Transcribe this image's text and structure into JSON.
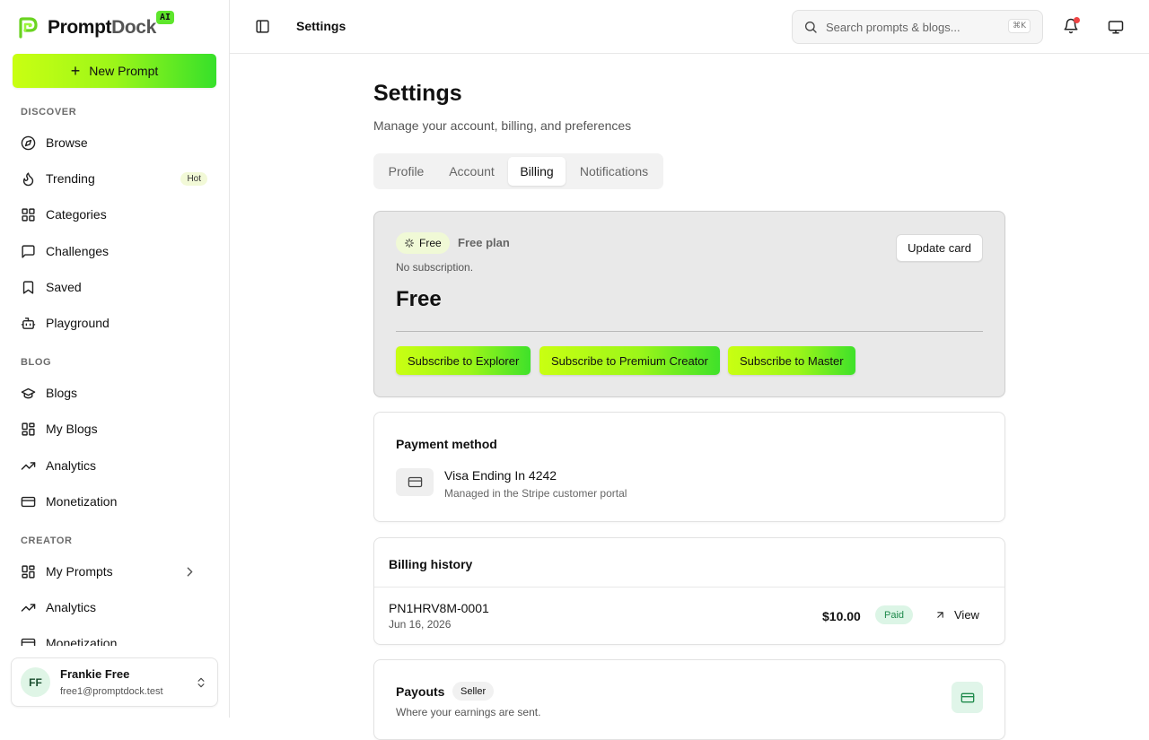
{
  "brand": {
    "name_part1": "Prompt",
    "name_part2": "Dock",
    "badge": "AI"
  },
  "sidebar": {
    "new_prompt_label": "New Prompt",
    "discover_label": "DISCOVER",
    "discover_items": [
      {
        "label": "Browse",
        "icon": "compass-icon"
      },
      {
        "label": "Trending",
        "icon": "flame-icon",
        "badge": "Hot"
      },
      {
        "label": "Categories",
        "icon": "grid-icon"
      },
      {
        "label": "Challenges",
        "icon": "message-square-icon"
      },
      {
        "label": "Saved",
        "icon": "bookmark-icon"
      },
      {
        "label": "Playground",
        "icon": "bot-icon"
      }
    ],
    "blog_label": "BLOG",
    "blog_items": [
      {
        "label": "Blogs",
        "icon": "graduation-cap-icon"
      },
      {
        "label": "My Blogs",
        "icon": "grid-icon"
      },
      {
        "label": "Analytics",
        "icon": "trending-up-icon"
      },
      {
        "label": "Monetization",
        "icon": "credit-card-icon"
      }
    ],
    "creator_label": "CREATOR",
    "creator_items": [
      {
        "label": "My Prompts",
        "icon": "grid-icon"
      },
      {
        "label": "Analytics",
        "icon": "trending-up-icon"
      },
      {
        "label": "Monetization",
        "icon": "credit-card-icon"
      }
    ],
    "user": {
      "initials": "FF",
      "name": "Frankie Free",
      "email": "free1@promptdock.test"
    }
  },
  "topbar": {
    "title": "Settings",
    "search_placeholder": "Search prompts & blogs...",
    "search_shortcut": "⌘K"
  },
  "page": {
    "title": "Settings",
    "subtitle": "Manage your account, billing, and preferences",
    "tabs": [
      "Profile",
      "Account",
      "Billing",
      "Notifications"
    ],
    "active_tab": "Billing"
  },
  "plan": {
    "badge": "Free",
    "plan_name": "Free plan",
    "status": "No subscription.",
    "price": "Free",
    "update_card_label": "Update card",
    "subscribe_buttons": [
      "Subscribe to Explorer",
      "Subscribe to Premium Creator",
      "Subscribe to Master"
    ]
  },
  "payment_method": {
    "title": "Payment method",
    "card_label": "Visa Ending In 4242",
    "card_sub": "Managed in the Stripe customer portal"
  },
  "billing_history": {
    "title": "Billing history",
    "rows": [
      {
        "id": "PN1HRV8M-0001",
        "date": "Jun 16, 2026",
        "amount": "$10.00",
        "status": "Paid",
        "action": "View"
      }
    ]
  },
  "payouts": {
    "title": "Payouts",
    "badge": "Seller",
    "subtitle": "Where your earnings are sent."
  },
  "colors": {
    "accent_start": "#c9ff12",
    "accent_end": "#36e02a",
    "paid_text": "#1f8a4c",
    "notification_dot": "#ef4444"
  }
}
